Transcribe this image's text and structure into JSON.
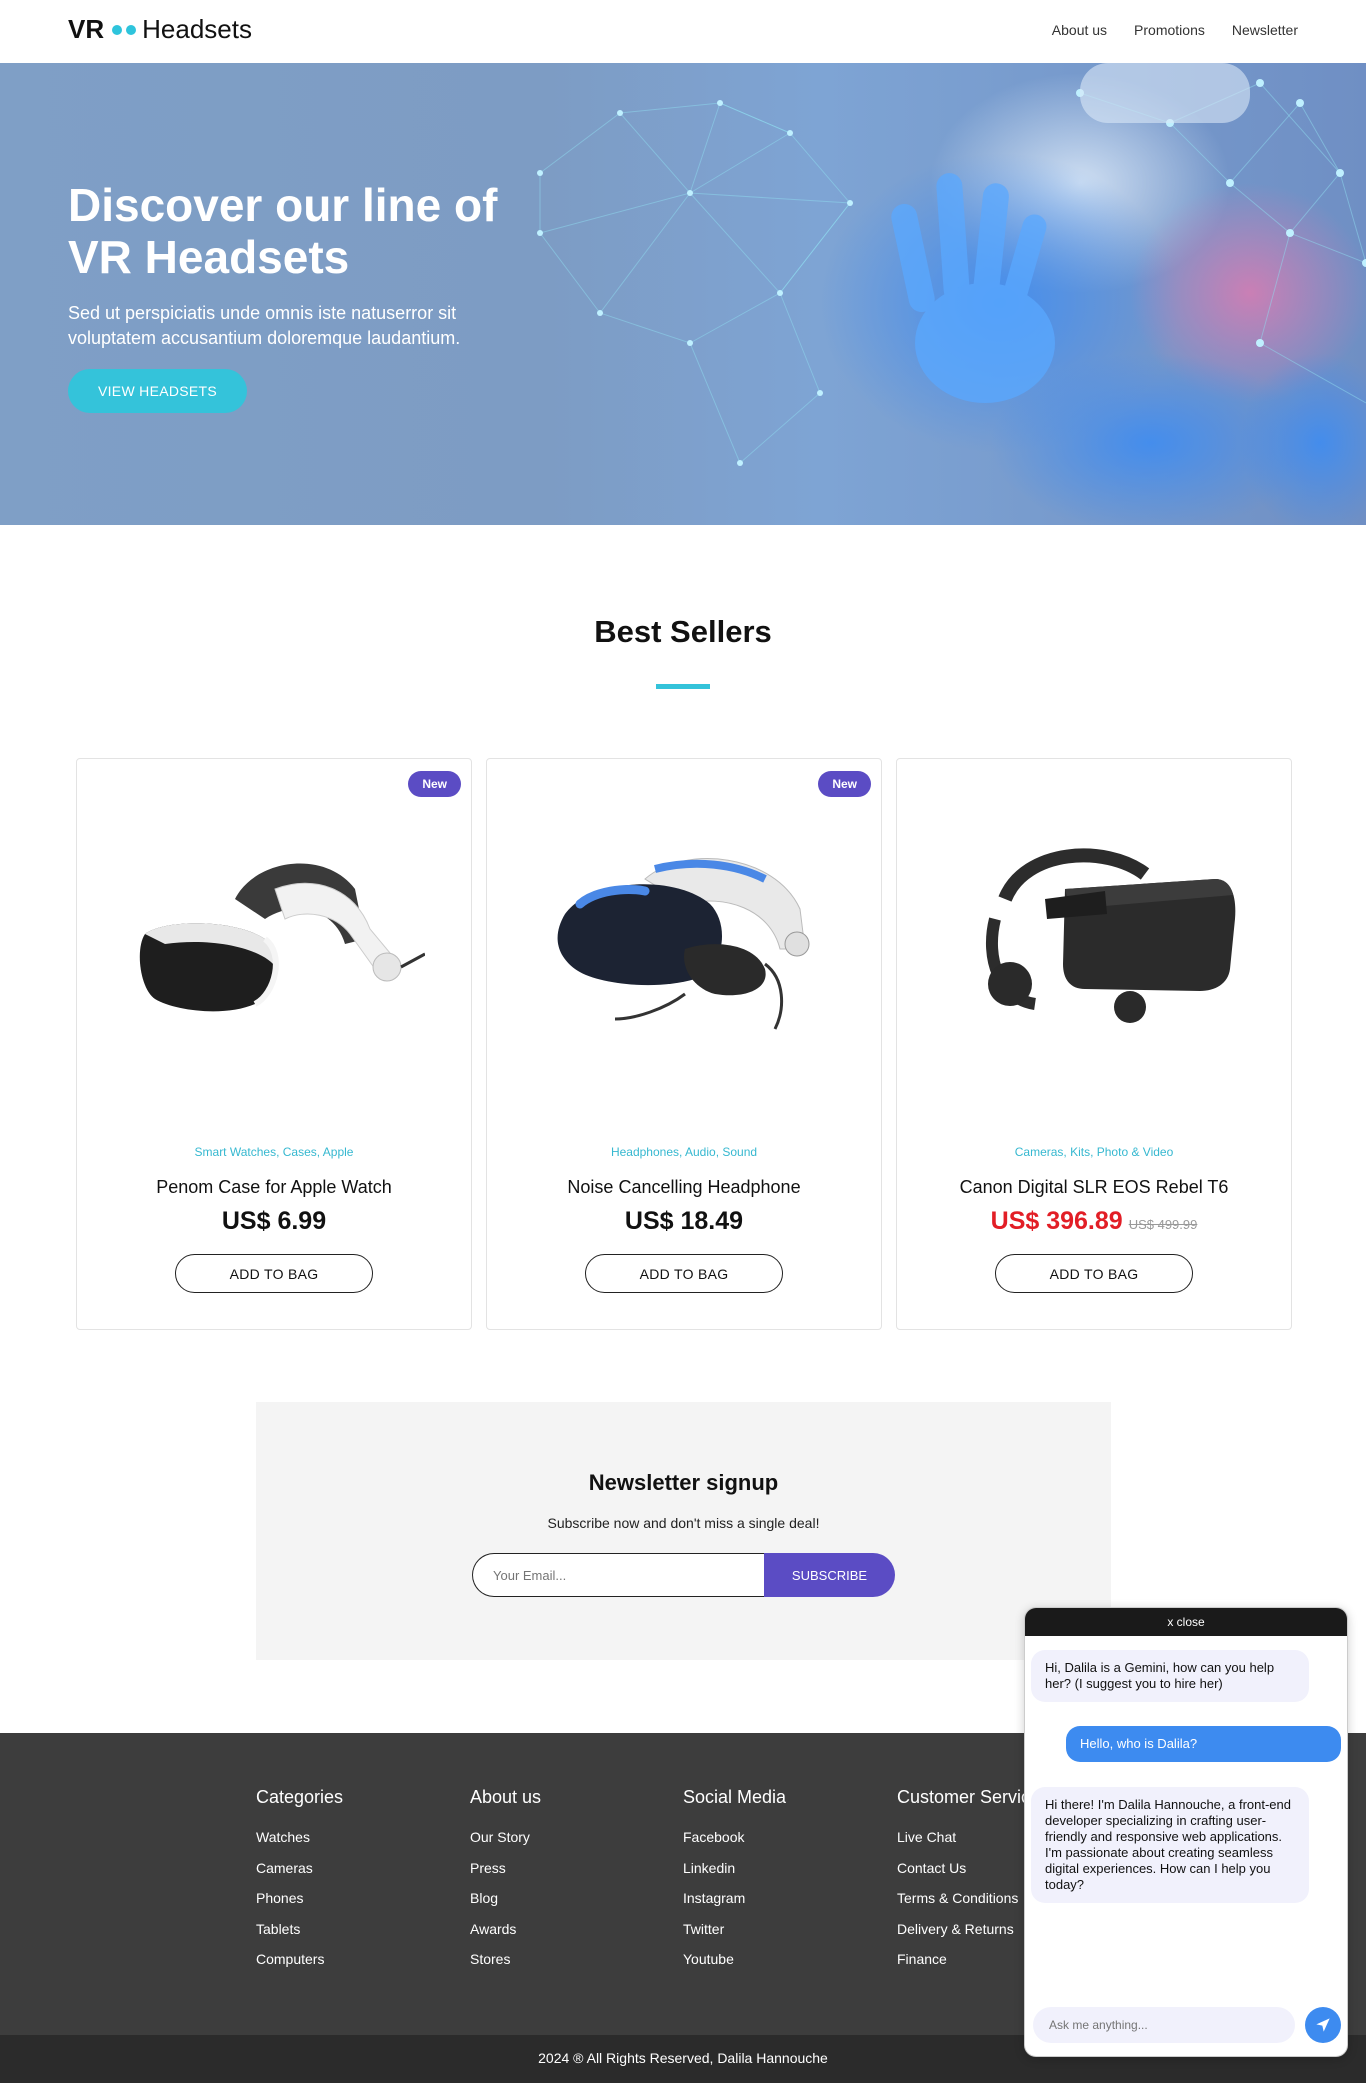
{
  "header": {
    "logo_prefix": "VR",
    "logo_suffix": "Headsets",
    "nav": [
      "About us",
      "Promotions",
      "Newsletter"
    ]
  },
  "hero": {
    "title": "Discover our line of VR Headsets",
    "subtitle": "Sed ut perspiciatis unde omnis iste natuserror sit voluptatem accusantium doloremque laudantium.",
    "button": "VIEW HEADSETS"
  },
  "best_sellers": {
    "title": "Best Sellers",
    "products": [
      {
        "badge": "New",
        "categories": "Smart Watches, Cases, Apple",
        "name": "Penom Case for Apple Watch",
        "price": "US$ 6.99",
        "old_price": "",
        "button": "ADD TO BAG"
      },
      {
        "badge": "New",
        "categories": "Headphones, Audio, Sound",
        "name": "Noise Cancelling Headphone",
        "price": "US$ 18.49",
        "old_price": "",
        "button": "ADD TO BAG"
      },
      {
        "badge": "",
        "categories": "Cameras, Kits, Photo & Video",
        "name": "Canon Digital SLR EOS Rebel T6",
        "price": "US$ 396.89",
        "old_price": "US$ 499.99",
        "button": "ADD TO BAG"
      }
    ]
  },
  "newsletter": {
    "title": "Newsletter signup",
    "subtitle": "Subscribe now and don't miss a single deal!",
    "placeholder": "Your Email...",
    "button": "SUBSCRIBE"
  },
  "footer": {
    "columns": [
      {
        "title": "Categories",
        "links": [
          "Watches",
          "Cameras",
          "Phones",
          "Tablets",
          "Computers"
        ]
      },
      {
        "title": "About us",
        "links": [
          "Our Story",
          "Press",
          "Blog",
          "Awards",
          "Stores"
        ]
      },
      {
        "title": "Social Media",
        "links": [
          "Facebook",
          "Linkedin",
          "Instagram",
          "Twitter",
          "Youtube"
        ]
      },
      {
        "title": "Customer Service",
        "links": [
          "Live Chat",
          "Contact Us",
          "Terms & Conditions",
          "Delivery & Returns",
          "Finance"
        ]
      }
    ],
    "copyright": "2024 ® All Rights Reserved, Dalila Hannouche"
  },
  "chat": {
    "close": "x close",
    "messages": [
      {
        "role": "bot",
        "text": "Hi, Dalila is a Gemini, how can you help her? (I suggest you to hire her)"
      },
      {
        "role": "user",
        "text": "Hello, who is Dalila?"
      },
      {
        "role": "bot",
        "text": "Hi there! I'm Dalila Hannouche, a front-end developer specializing in crafting user-friendly and responsive web applications. I'm passionate about creating seamless digital experiences. How can I help you today?"
      }
    ],
    "placeholder": "Ask me anything..."
  },
  "colors": {
    "accent": "#34c3da",
    "purple": "#5b4cc4",
    "sale_red": "#e21e26",
    "chat_blue": "#3d8bf0",
    "footer_bg": "#3d3d3d"
  }
}
